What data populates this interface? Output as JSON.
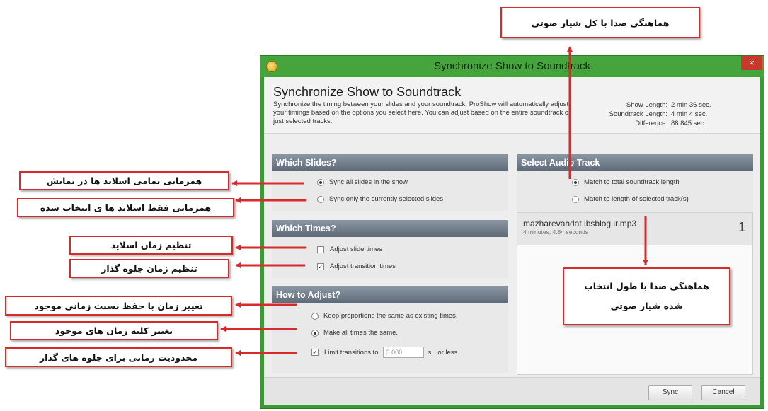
{
  "window": {
    "title": "Synchronize Show to Soundtrack",
    "close_glyph": "×"
  },
  "header": {
    "title": "Synchronize Show to Soundtrack",
    "description": "Synchronize the timing between your slides and your soundtrack. ProShow will automatically adjust your timings based on the options you select here. You can adjust based on the entire soundtrack or just selected tracks.",
    "stats": [
      {
        "label": "Show Length:",
        "value": "2 min 36 sec."
      },
      {
        "label": "Soundtrack Length:",
        "value": "4 min 4 sec."
      },
      {
        "label": "Difference:",
        "value": "88.845 sec."
      }
    ]
  },
  "which_slides": {
    "heading": "Which Slides?",
    "options": [
      {
        "label": "Sync all slides in the show",
        "selected": true
      },
      {
        "label": "Sync only the currently selected slides",
        "selected": false
      }
    ]
  },
  "which_times": {
    "heading": "Which Times?",
    "options": [
      {
        "label": "Adjust slide times",
        "checked": false
      },
      {
        "label": "Adjust transition times",
        "checked": true
      }
    ]
  },
  "how_to_adjust": {
    "heading": "How to Adjust?",
    "options": [
      {
        "label": "Keep proportions the same as existing times.",
        "selected": false
      },
      {
        "label": "Make all times the same.",
        "selected": true
      }
    ],
    "limit": {
      "label": "Limit transitions to",
      "checked": true,
      "value": "3.000",
      "unit": "s",
      "suffix": "or less"
    }
  },
  "audio_track": {
    "heading": "Select Audio Track",
    "options": [
      {
        "label": "Match to total soundtrack length",
        "selected": true
      },
      {
        "label": "Match to length of selected track(s)",
        "selected": false
      }
    ],
    "track": {
      "name": "mazharevahdat.ibsblog.ir.mp3",
      "duration": "4 minutes, 4.84 seconds",
      "number": "1"
    }
  },
  "buttons": {
    "sync": "Sync",
    "cancel": "Cancel"
  },
  "annotations": {
    "total_soundtrack": "هماهنگی صدا با کل شیار صوتی",
    "sync_all": "همزمانی تمامی اسلاید ها در نمایش",
    "sync_selected": "همزمانی  فقط اسلاید ها ی انتخاب شده",
    "slide_time": "تنظیم زمان اسلاید",
    "transition_time": "تنظیم زمان جلوه گذار",
    "keep_proportion": "تغییر زمان با حفظ نسبت زمانی موجود",
    "make_same": "تغییر کلیه زمان های موجود",
    "limit_transitions": "محدودیت زمانی برای جلوه های گذار",
    "selected_track_line1": "هماهنگی صدا با طول انتخاب",
    "selected_track_line2": "شده شیار صوتی"
  },
  "colors": {
    "window_frame": "#3c9a34",
    "panel_heading": "#6b7683",
    "callout_border": "#d82a2a",
    "arrow": "#d82a2a"
  }
}
